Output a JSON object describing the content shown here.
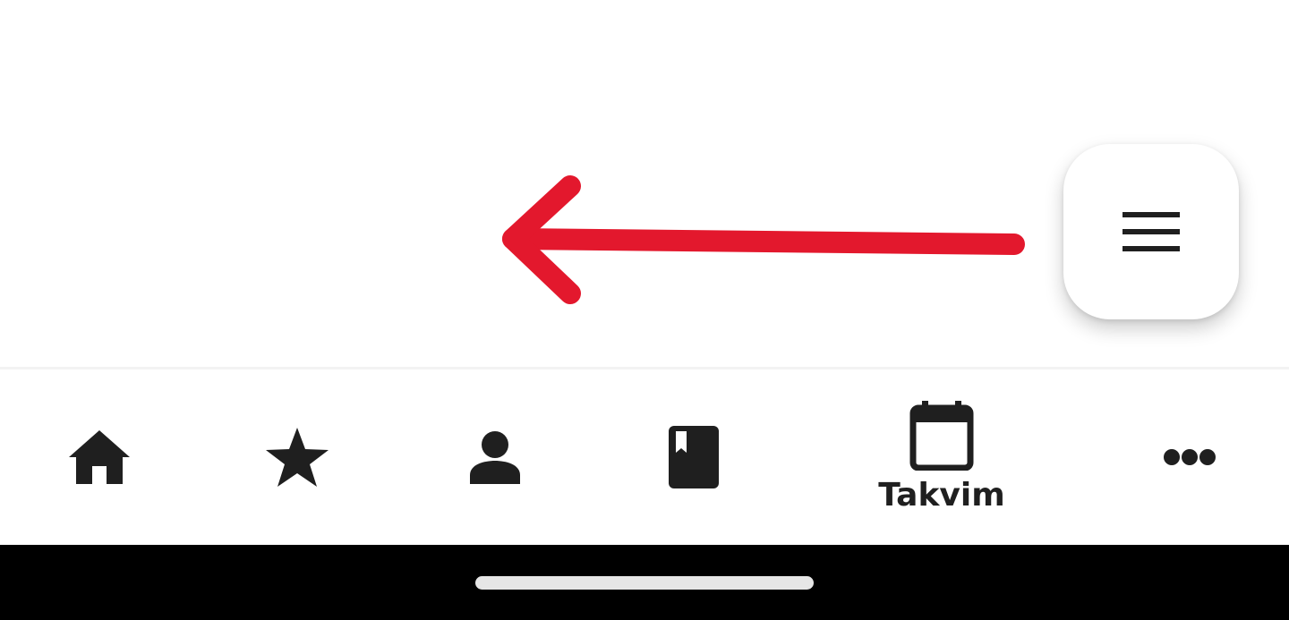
{
  "annotation": {
    "arrow_color": "#e3182d",
    "arrow_direction": "left",
    "arrow_icon": "left-arrow-annotation"
  },
  "fab": {
    "icon": "hamburger-menu-icon"
  },
  "bottom_nav": {
    "items": [
      {
        "id": "home",
        "icon": "home-icon",
        "label": ""
      },
      {
        "id": "favorites",
        "icon": "star-icon",
        "label": ""
      },
      {
        "id": "profile",
        "icon": "person-icon",
        "label": ""
      },
      {
        "id": "book",
        "icon": "book-bookmark-icon",
        "label": ""
      },
      {
        "id": "calendar",
        "icon": "calendar-icon",
        "label": "Takvim",
        "active": true
      },
      {
        "id": "more",
        "icon": "more-dots-icon",
        "label": ""
      }
    ]
  },
  "colors": {
    "icon": "#1f1f1f",
    "accent_annotation": "#e3182d",
    "background": "#ffffff",
    "system_bar": "#000000"
  }
}
